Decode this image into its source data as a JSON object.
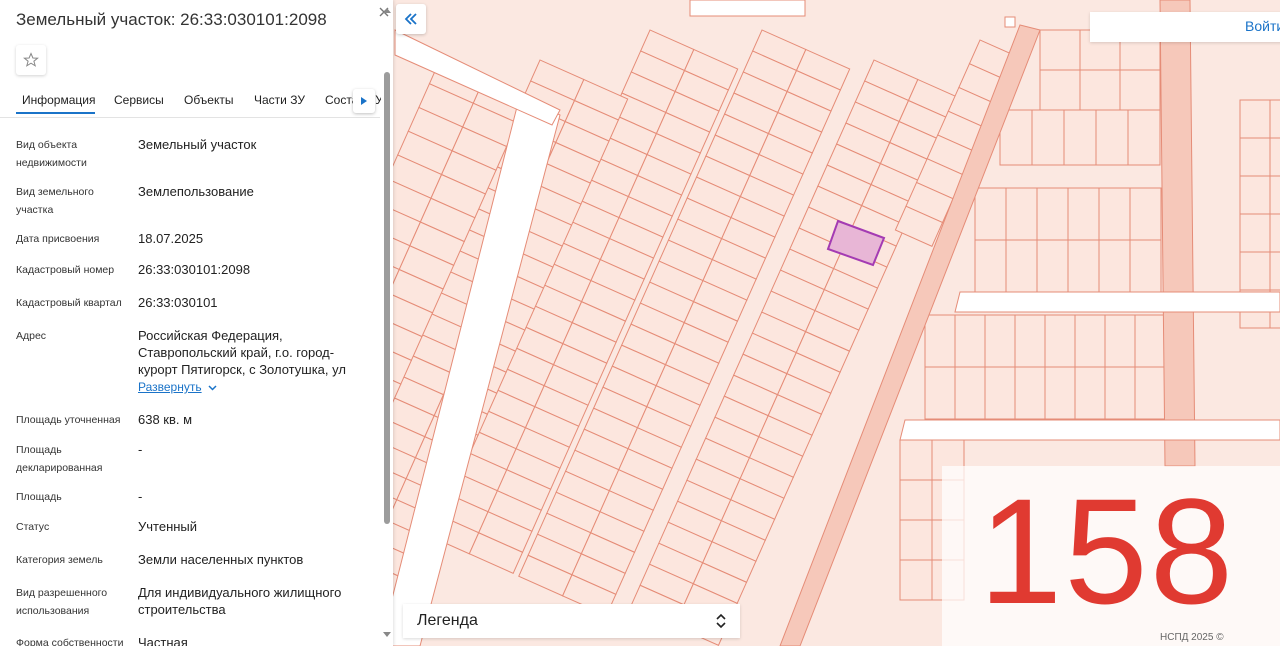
{
  "panel": {
    "title": "Земельный участок: 26:33:030101:2098",
    "tabs": [
      {
        "label": "Информация"
      },
      {
        "label": "Сервисы"
      },
      {
        "label": "Объекты"
      },
      {
        "label": "Части ЗУ"
      },
      {
        "label": "Состав ЗУ"
      }
    ],
    "fields": [
      {
        "key": "Вид объекта недвижимости",
        "value": "Земельный участок"
      },
      {
        "key": "Вид земельного участка",
        "value": "Землепользование"
      },
      {
        "key": "Дата присвоения",
        "value": "18.07.2025"
      },
      {
        "key": "Кадастровый номер",
        "value": "26:33:030101:2098"
      },
      {
        "key": "Кадастровый квартал",
        "value": "26:33:030101"
      },
      {
        "key": "Адрес",
        "value": "Российская Федерация, Ставропольский край, г.о. город-курорт Пятигорск, с Золотушка, ул"
      },
      {
        "key": "Площадь уточненная",
        "value": "638 кв. м"
      },
      {
        "key": "Площадь декларированная",
        "value": "-"
      },
      {
        "key": "Площадь",
        "value": "-"
      },
      {
        "key": "Статус",
        "value": "Учтенный"
      },
      {
        "key": "Категория земель",
        "value": "Земли населенных пунктов"
      },
      {
        "key": "Вид разрешенного использования",
        "value": "Для индивидуального жилищного строительства"
      },
      {
        "key": "Форма собственности",
        "value": "Частная"
      }
    ],
    "expand_label": "Развернуть"
  },
  "map": {
    "login_label": "Войти",
    "legend_label": "Легенда",
    "watermark_number": "158",
    "copyright": "НСПД 2025 ©",
    "colors": {
      "background": "#fbe8e1",
      "parcel_stroke": "#e58c77",
      "road_fill": "#ffffff",
      "selected_fill": "#e8b6d6",
      "selected_stroke": "#a43bb3",
      "accent": "#1a73c8",
      "watermark": "#e03a31"
    }
  },
  "icons": {
    "close": "close-icon",
    "star": "star-icon",
    "collapse": "double-chevron-left-icon",
    "tab_next": "chevron-right-icon",
    "expand": "chevron-down-icon",
    "legend_toggle": "sort-arrows-icon"
  }
}
